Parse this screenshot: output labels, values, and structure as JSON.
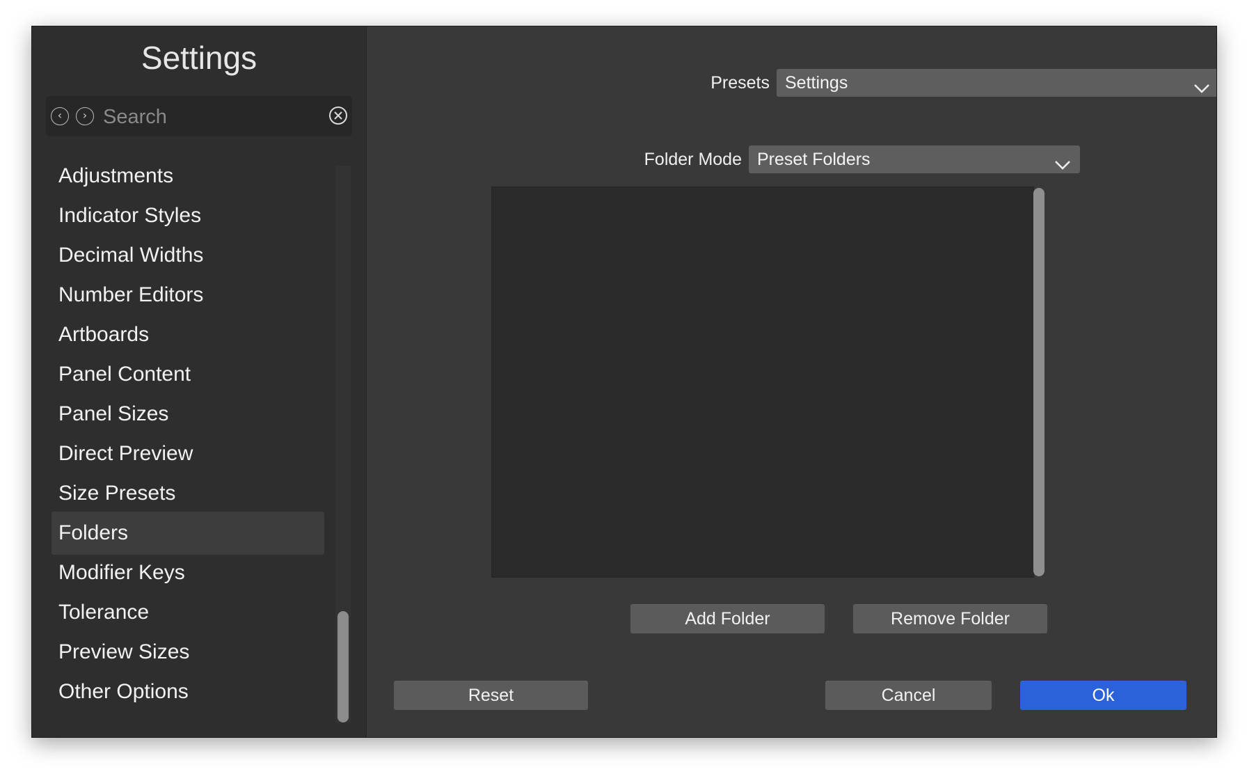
{
  "sidebar": {
    "title": "Settings",
    "search_placeholder": "Search",
    "items": [
      {
        "label": "Adjustments"
      },
      {
        "label": "Indicator Styles"
      },
      {
        "label": "Decimal Widths"
      },
      {
        "label": "Number Editors"
      },
      {
        "label": "Artboards"
      },
      {
        "label": "Panel Content"
      },
      {
        "label": "Panel Sizes"
      },
      {
        "label": "Direct Preview"
      },
      {
        "label": "Size Presets"
      },
      {
        "label": "Folders",
        "selected": true
      },
      {
        "label": "Modifier Keys"
      },
      {
        "label": "Tolerance"
      },
      {
        "label": "Preview Sizes"
      },
      {
        "label": "Other Options"
      }
    ]
  },
  "main": {
    "presets": {
      "label": "Presets",
      "value": "Settings"
    },
    "folder_mode": {
      "label": "Folder Mode",
      "value": "Preset Folders"
    },
    "add_folder_label": "Add Folder",
    "remove_folder_label": "Remove Folder"
  },
  "footer": {
    "reset_label": "Reset",
    "cancel_label": "Cancel",
    "ok_label": "Ok"
  },
  "colors": {
    "window_bg": "#393939",
    "sidebar_bg": "#2e2e2e",
    "accent": "#2b62d9"
  },
  "icons": [
    "chevron-left-icon",
    "chevron-right-icon",
    "clear-icon",
    "chevron-down-icon"
  ]
}
